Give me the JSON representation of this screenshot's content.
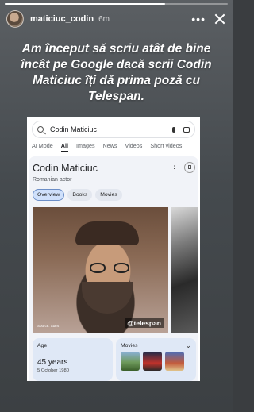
{
  "story": {
    "progress": 0.72,
    "username": "maticiuc_codin",
    "time": "6m",
    "caption": "Am început să scriu atât de bine încât pe Google dacă scrii Codin Maticiuc îți dă prima poză cu Telespan."
  },
  "google": {
    "search_query": "Codin Maticiuc",
    "tabs": [
      "AI Mode",
      "All",
      "Images",
      "News",
      "Videos",
      "Short videos"
    ],
    "active_tab": "All",
    "knowledge_panel": {
      "name": "Codin Maticiuc",
      "subtitle": "Romanian actor",
      "chips": [
        "Overview",
        "Books",
        "Movies"
      ],
      "photo_credit": "Source: Stars",
      "mention": "@telespan",
      "age_label": "Age",
      "age_value": "45 years",
      "birth_date": "5 October 1980",
      "movies_label": "Movies"
    }
  },
  "icons": [
    "search-icon",
    "mic-icon",
    "lens-icon",
    "more-icon",
    "close-icon",
    "bookmark-icon",
    "chevron-down-icon"
  ]
}
